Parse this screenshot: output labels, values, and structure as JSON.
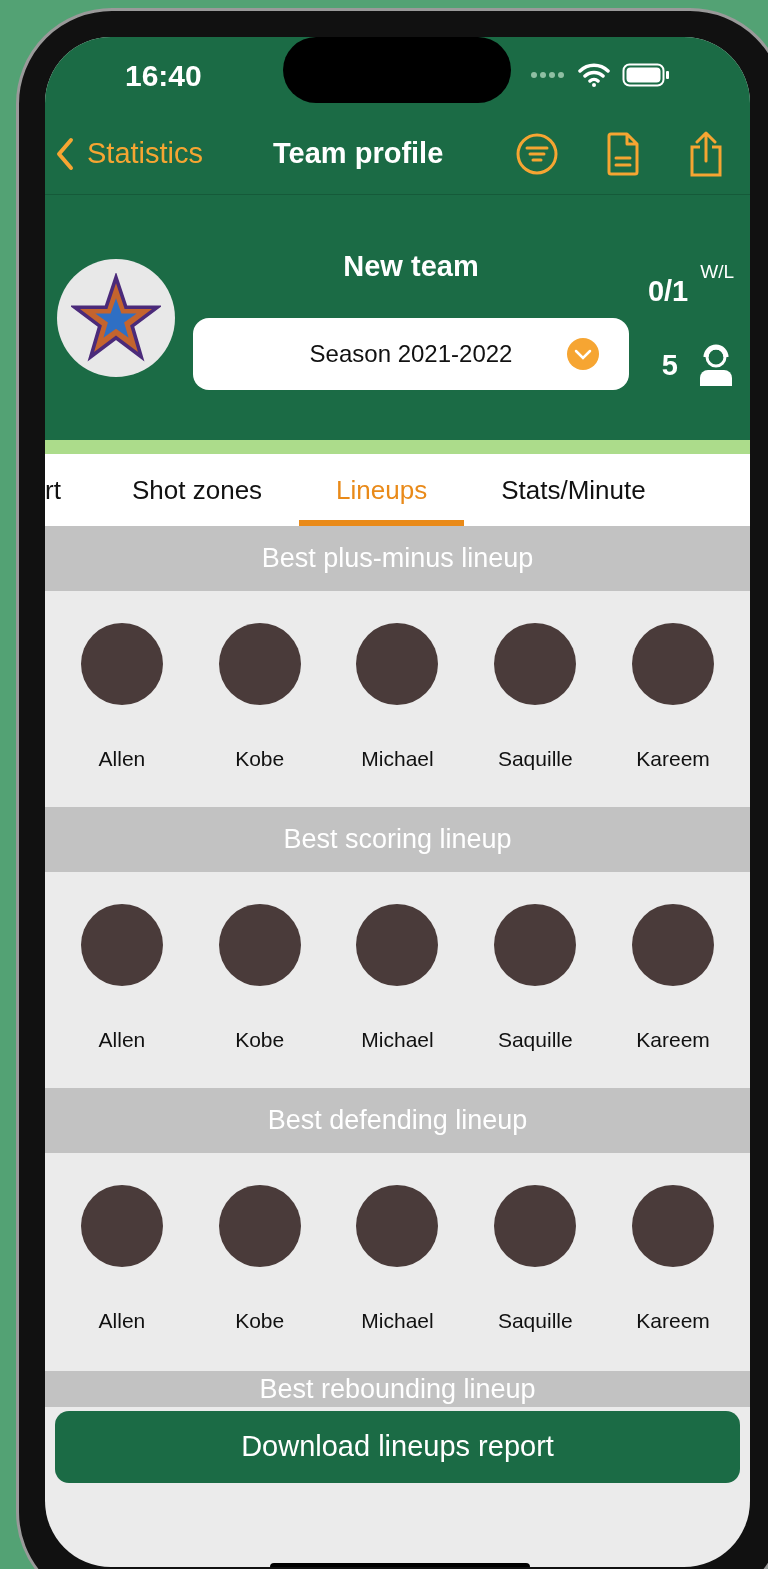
{
  "status_bar": {
    "time": "16:40"
  },
  "nav": {
    "back_label": "Statistics",
    "title": "Team profile"
  },
  "team": {
    "name": "New team",
    "record": "0/1",
    "record_label": "W/L",
    "season": "Season 2021-2022",
    "players_count": "5"
  },
  "tabs": [
    {
      "label": "rt",
      "selected": false
    },
    {
      "label": "Shot zones",
      "selected": false
    },
    {
      "label": "Lineups",
      "selected": true
    },
    {
      "label": "Stats/Minute",
      "selected": false
    }
  ],
  "sections": [
    {
      "title": "Best plus-minus lineup",
      "players": [
        "Allen",
        "Kobe",
        "Michael",
        "Saquille",
        "Kareem"
      ]
    },
    {
      "title": "Best scoring lineup",
      "players": [
        "Allen",
        "Kobe",
        "Michael",
        "Saquille",
        "Kareem"
      ]
    },
    {
      "title": "Best defending lineup",
      "players": [
        "Allen",
        "Kobe",
        "Michael",
        "Saquille",
        "Kareem"
      ]
    },
    {
      "title": "Best rebounding lineup"
    }
  ],
  "download_button": "Download lineups report"
}
